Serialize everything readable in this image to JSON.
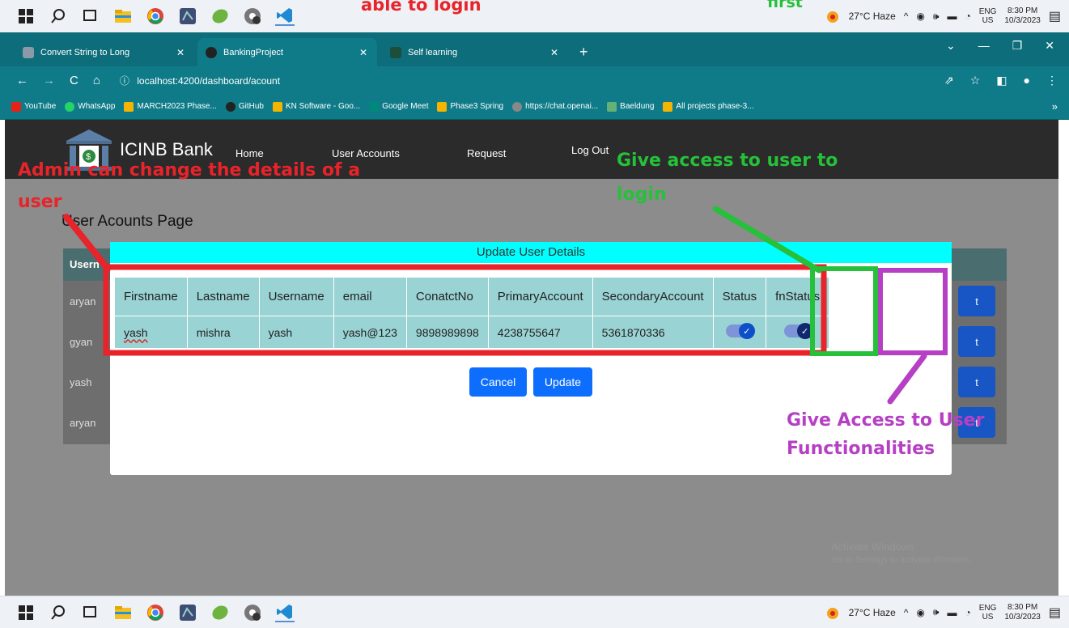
{
  "taskbar": {
    "weather": "27°C Haze",
    "lang_top": "ENG",
    "lang_bottom": "US",
    "time": "8:30 PM",
    "date": "10/3/2023"
  },
  "browser": {
    "tabs": [
      {
        "label": "Convert String to Long",
        "icon": "site-icon"
      },
      {
        "label": "BankingProject",
        "icon": "angular-icon"
      },
      {
        "label": "Self learning",
        "icon": "tab-icon"
      }
    ],
    "url": "localhost:4200/dashboard/acount",
    "bookmarks": [
      "YouTube",
      "WhatsApp",
      "MARCH2023 Phase...",
      "GitHub",
      "KN Software - Goo...",
      "Google Meet",
      "Phase3 Spring",
      "https://chat.openai...",
      "Baeldung",
      "All projects phase-3..."
    ]
  },
  "app": {
    "brand": "ICINB Bank",
    "nav": [
      "Home",
      "User Accounts",
      "Request",
      "Log Out"
    ],
    "page_title": "User Acounts Page",
    "bg_header": "Usern",
    "bg_rows": [
      "aryan",
      "gyan",
      "yash",
      "aryan"
    ],
    "bg_btn_label": "t"
  },
  "modal": {
    "title": "Update User Details",
    "columns": [
      "Firstname",
      "Lastname",
      "Username",
      "email",
      "ConatctNo",
      "PrimaryAccount",
      "SecondaryAccount",
      "Status",
      "fnStatus"
    ],
    "row": {
      "firstname": "yash",
      "lastname": "mishra",
      "username": "yash",
      "email": "yash@123",
      "contact": "9898989898",
      "primary": "4238755647",
      "secondary": "5361870336"
    },
    "cancel_label": "Cancel",
    "update_label": "Update"
  },
  "annotations": {
    "top_center": "able to login",
    "top_right": "first",
    "red": "Admin can change the details of a",
    "red_2": "user",
    "green": "Give access to user to",
    "green_2": "login",
    "purple": "Give Access to User",
    "purple_2": "Functionalities"
  },
  "watermark": {
    "line1": "Activate Windows",
    "line2": "Go to Settings to activate Windows."
  },
  "colors": {
    "annotation_red": "#e8232a",
    "annotation_green": "#26c03a",
    "annotation_purple": "#b640c4",
    "modal_header": "#00ffff",
    "table_cell": "#9ad3d4"
  }
}
